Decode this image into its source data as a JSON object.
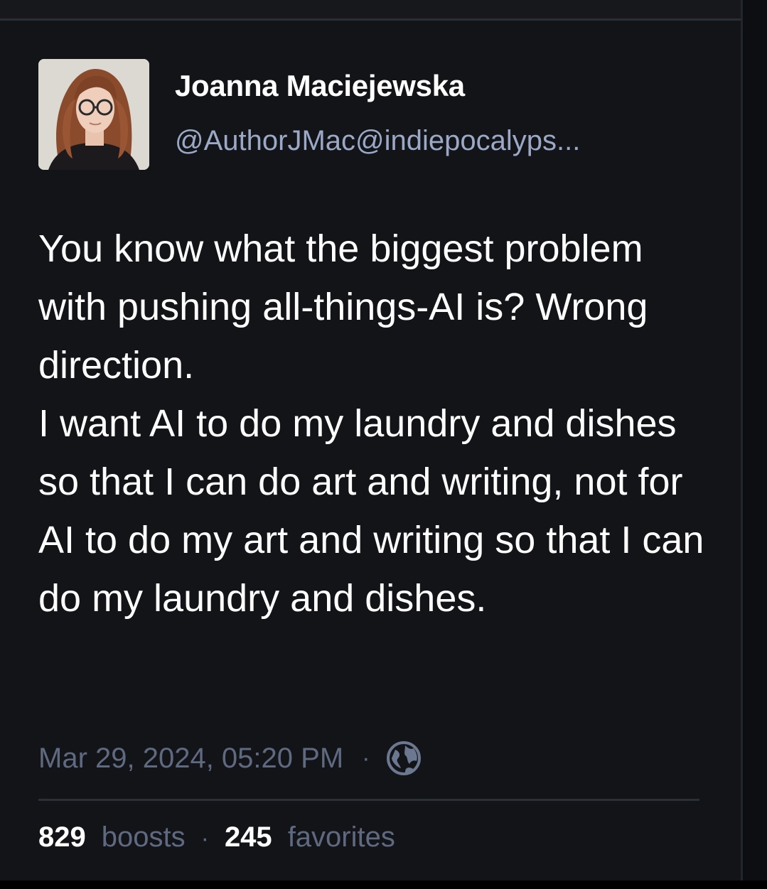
{
  "author": {
    "display_name": "Joanna Maciejewska",
    "account": "@AuthorJMac@indiepocalyps..."
  },
  "content": {
    "lines": [
      "You know what the biggest problem with pushing all-things-AI is? Wrong direction.",
      "I want AI to do my laundry and dishes so that I can do art and writing, not for AI to do my art and writing so that I can do my laundry and dishes."
    ]
  },
  "meta": {
    "timestamp": "Mar 29, 2024, 05:20 PM",
    "separator": "·",
    "visibility_icon": "globe-icon"
  },
  "stats": {
    "boosts_count": "829",
    "boosts_label": "boosts",
    "separator": "·",
    "favorites_count": "245",
    "favorites_label": "favorites"
  },
  "colors": {
    "background": "#121418",
    "text": "#ffffff",
    "account": "#9ba8c6",
    "muted": "#5f6a80"
  }
}
